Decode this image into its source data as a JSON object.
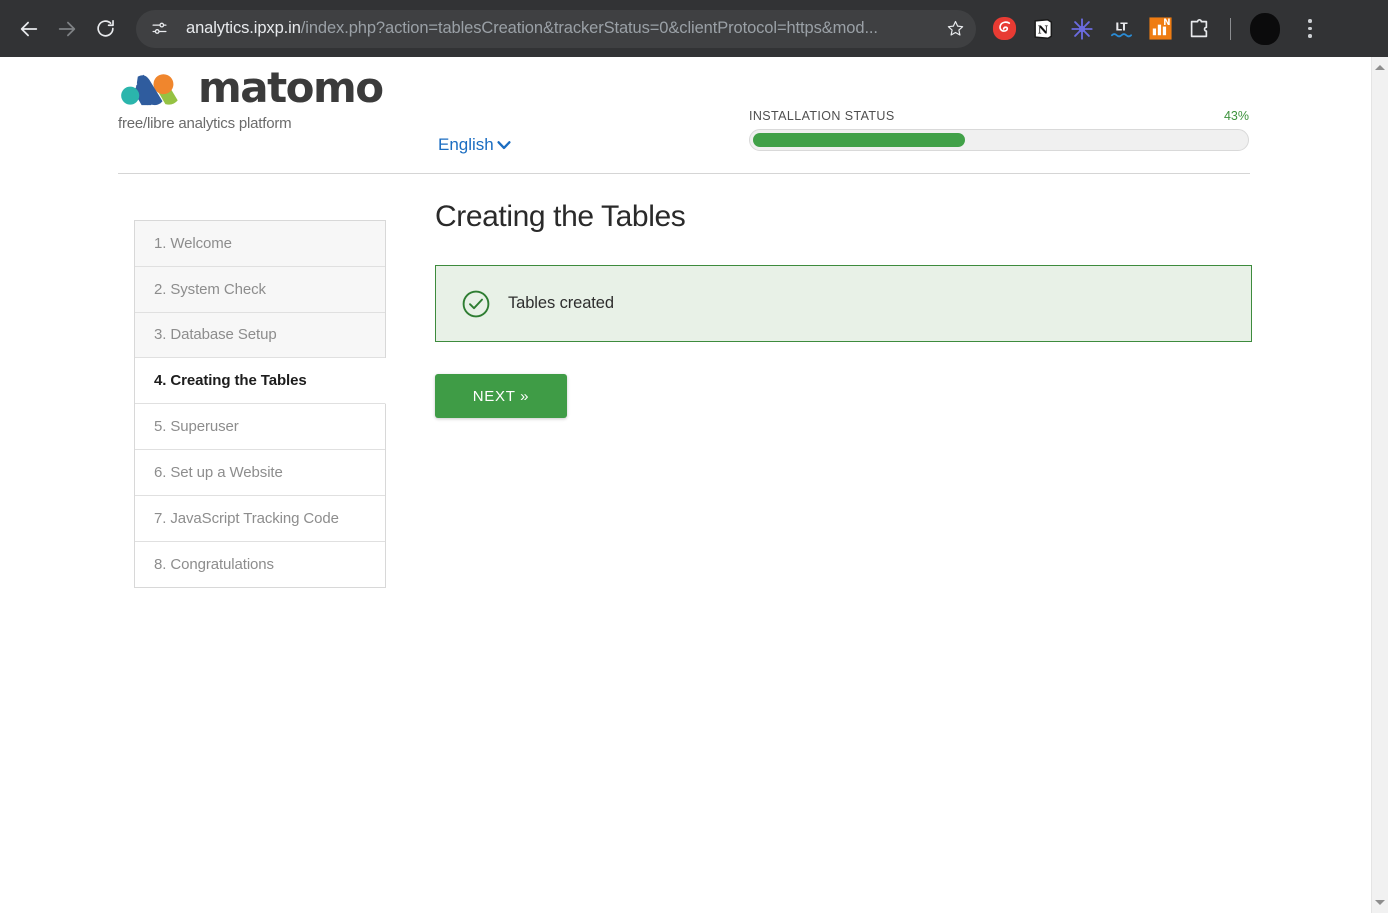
{
  "browser": {
    "nav": {
      "back_label": "Back",
      "forward_label": "Forward",
      "reload_label": "Reload"
    },
    "omnibox": {
      "site_info_icon": "site-settings-icon",
      "url_host": "analytics.ipxp.in",
      "url_path": "/index.php?action=tablesCreation&trackerStatus=0&clientProtocol=https&mod...",
      "bookmark_icon": "star-icon"
    },
    "extensions": [
      {
        "name": "extension-icon-red-q",
        "label": "Q"
      },
      {
        "name": "extension-icon-notion",
        "label": "N"
      },
      {
        "name": "extension-icon-asterisk",
        "label": "*"
      },
      {
        "name": "extension-icon-languagetool",
        "label": "LT"
      },
      {
        "name": "extension-icon-orange-chart",
        "label": "N"
      },
      {
        "name": "extension-icon-puzzle",
        "label": "puzzle"
      }
    ],
    "profile_icon": "avatar-icon",
    "menu_icon": "kebab-menu-icon"
  },
  "header": {
    "logo_word": "matomo",
    "logo_mark_colors": {
      "teal": "#2bb5ac",
      "blue": "#2f5c9e",
      "orange": "#f0862d",
      "green": "#95c243"
    },
    "tagline": "free/libre analytics platform",
    "language": {
      "selected": "English",
      "chevron_icon": "chevron-down-icon"
    },
    "installation": {
      "label": "INSTALLATION STATUS",
      "percent_label": "43%",
      "percent_value": 43,
      "bar_color": "#41a148"
    }
  },
  "steps": [
    {
      "label": "1. Welcome",
      "state": "done"
    },
    {
      "label": "2. System Check",
      "state": "done"
    },
    {
      "label": "3. Database Setup",
      "state": "done"
    },
    {
      "label": "4. Creating the Tables",
      "state": "active"
    },
    {
      "label": "5. Superuser",
      "state": "pending"
    },
    {
      "label": "6. Set up a Website",
      "state": "pending"
    },
    {
      "label": "7. JavaScript Tracking Code",
      "state": "pending"
    },
    {
      "label": "8. Congratulations",
      "state": "pending"
    }
  ],
  "content": {
    "title": "Creating the Tables",
    "notice": {
      "icon": "check-circle-icon",
      "message": "Tables created",
      "border_color": "#3d8b3d",
      "background_color": "#e8f1e7"
    },
    "next_button": {
      "label": "NEXT »",
      "color": "#3f9c46"
    }
  },
  "scrollbar": {
    "up_icon": "scroll-up-arrow-icon",
    "down_icon": "scroll-down-arrow-icon"
  }
}
